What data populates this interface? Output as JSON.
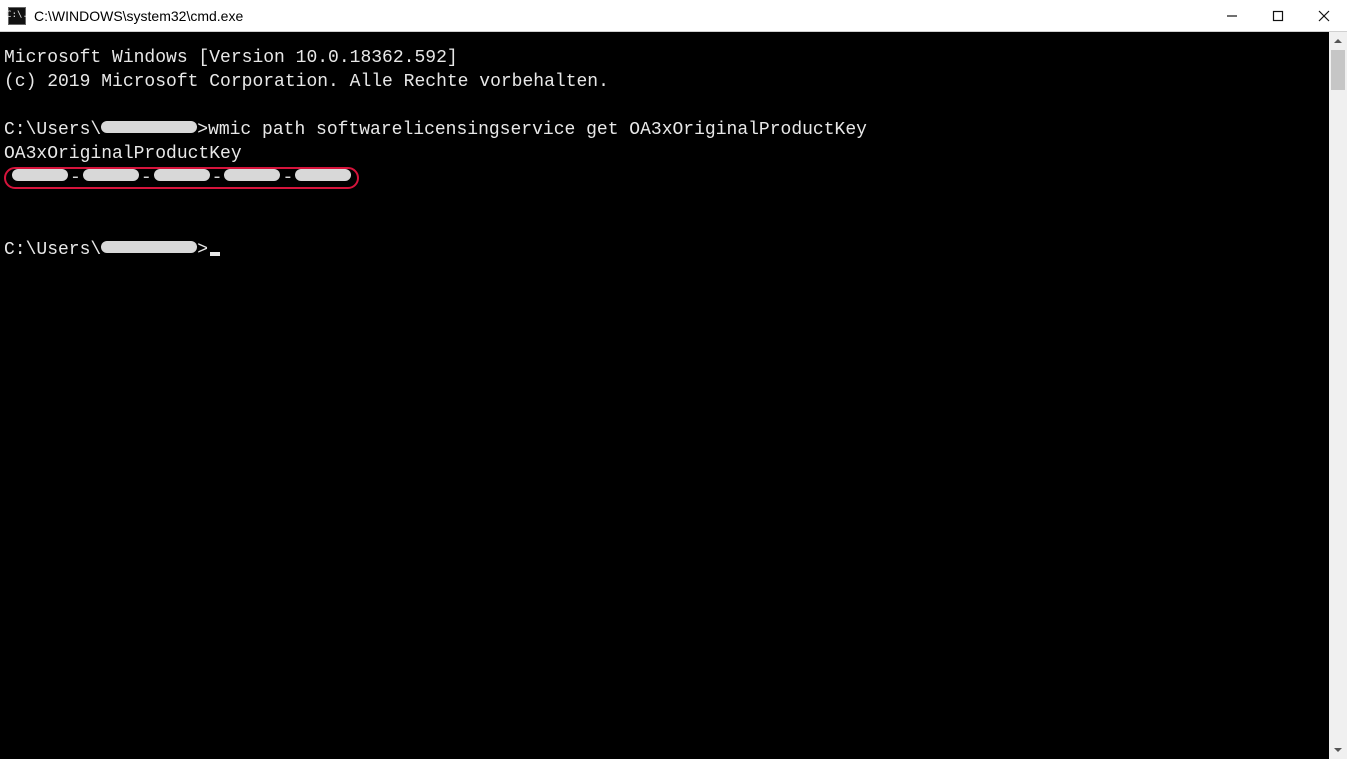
{
  "window": {
    "title": "C:\\WINDOWS\\system32\\cmd.exe",
    "icon_label": "C:\\."
  },
  "terminal": {
    "line1": "Microsoft Windows [Version 10.0.18362.592]",
    "line2": "(c) 2019 Microsoft Corporation. Alle Rechte vorbehalten.",
    "prompt_prefix": "C:\\Users\\",
    "prompt_suffix": ">",
    "command": "wmic path softwarelicensingservice get OA3xOriginalProductKey",
    "result_header": "OA3xOriginalProductKey",
    "product_key_redacted": true,
    "product_key_segments": 5,
    "username_redacted": true
  }
}
